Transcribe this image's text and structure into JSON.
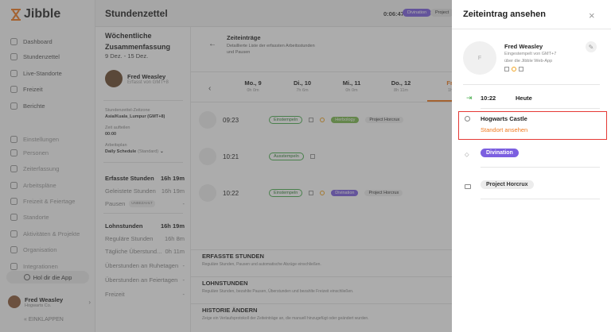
{
  "app": {
    "logo": "Jibble"
  },
  "sidebar": {
    "items": [
      {
        "label": "Dashboard",
        "icon": "dashboard-icon"
      },
      {
        "label": "Stundenzettel",
        "icon": "clock-icon"
      },
      {
        "label": "Live-Standorte",
        "icon": "location-icon"
      },
      {
        "label": "Freizeit",
        "icon": "calendar-icon"
      },
      {
        "label": "Berichte",
        "icon": "report-icon"
      },
      {
        "label": "Einstellungen",
        "icon": "chevron-up-icon"
      },
      {
        "label": "Personen",
        "icon": "people-icon"
      },
      {
        "label": "Zeiterfassung",
        "icon": "time-tracking-icon"
      },
      {
        "label": "Arbeitspläne",
        "icon": "schedule-icon"
      },
      {
        "label": "Freizeit & Feiertage",
        "icon": "holiday-icon"
      },
      {
        "label": "Standorte",
        "icon": "pin-icon"
      },
      {
        "label": "Aktivitäten & Projekte",
        "icon": "tag-icon"
      },
      {
        "label": "Organisation",
        "icon": "gear-icon"
      },
      {
        "label": "Integrationen",
        "icon": "puzzle-icon"
      }
    ],
    "help": "Hol dir die App",
    "user": {
      "name": "Fred Weasley",
      "org": "Hogwarts Co."
    },
    "collapse": "EINKLAPPEN"
  },
  "header": {
    "title": "Stundenzettel",
    "timer": "0:06:47",
    "activity": "Divination",
    "project": "Project"
  },
  "summary": {
    "title": "Wöchentliche Zusammenfassung",
    "range": "9 Dez. - 15 Dez.",
    "person": {
      "name": "Fred Weasley",
      "sub": "Erfasst von GMT+8"
    },
    "tz_label": "Stundenzettel-Zeitzone",
    "tz_value": "Asia/Kuala_Lumpur (GMT+8)",
    "round_label": "Zeit aufteilen",
    "round_value": "00:00",
    "sched_label": "Arbeitsplan",
    "sched_value": "Daily Schedule",
    "sched_tag": "(Standard)",
    "rows": [
      {
        "label": "Erfasste Stunden",
        "value": "16h 19m",
        "strong": true
      },
      {
        "label": "Geleistete Stunden",
        "value": "16h 19m"
      },
      {
        "label": "Pausen",
        "value": "-",
        "tag": "UNBEZAHLT"
      },
      {
        "label": "Lohnstunden",
        "value": "16h 19m",
        "strong": true
      },
      {
        "label": "Reguläre Stunden",
        "value": "16h 8m"
      },
      {
        "label": "Tägliche Überstund...",
        "value": "0h 11m"
      },
      {
        "label": "Überstunden an Ruhetagen",
        "value": "-"
      },
      {
        "label": "Überstunden an Feiertagen",
        "value": "-"
      },
      {
        "label": "Freizeit",
        "value": "-"
      }
    ]
  },
  "main": {
    "section_title": "Zeiteinträge",
    "section_sub": "Detaillierte Liste der erfassten Arbeitsstunden und Pausen",
    "days": [
      {
        "d": "Mo., 9",
        "h": "0h 0m"
      },
      {
        "d": "Di., 10",
        "h": "7h 6m"
      },
      {
        "d": "Mi., 11",
        "h": "0h 0m"
      },
      {
        "d": "Do., 12",
        "h": "8h 11m"
      },
      {
        "d": "Fr.",
        "h": "1h"
      }
    ],
    "entries": [
      {
        "time": "09:23",
        "type": "Einstempeln",
        "activity": "Herbology",
        "project": "Project Horcrux",
        "act_color": "#7cba4f"
      },
      {
        "time": "10:21",
        "type": "Ausstempeln",
        "activity": "",
        "project": ""
      },
      {
        "time": "10:22",
        "type": "Einstempeln",
        "activity": "Divination",
        "project": "Project Horcrux",
        "act_color": "#7c5fe0"
      }
    ],
    "sections": [
      {
        "title": "ERFASSTE STUNDEN",
        "sub": "Reguläre Stunden, Pausen und automatische Abzüge einschließen."
      },
      {
        "title": "LOHNSTUNDEN",
        "sub": "Reguläre Stunden, bezahlte Pausen, Überstunden und bezahlte Freizeit einschließen."
      },
      {
        "title": "HISTORIE ÄNDERN",
        "sub": "Zeige ein Verlaufsprotokoll der Zeiteinträge an, die manuell hinzugefügt oder geändert wurden."
      }
    ]
  },
  "panel": {
    "title": "Zeiteintrag ansehen",
    "name": "Fred Weasley",
    "sub1": "Eingestempelt von GMT+7",
    "sub2": "über die Jibble Web-App",
    "time": "10:22",
    "day": "Heute",
    "location": "Hogwarts Castle",
    "location_link": "Standort ansehen",
    "activity": "Divination",
    "project": "Project Horcrux",
    "accent": "#f07a1f",
    "activity_color": "#7c5fe0"
  }
}
